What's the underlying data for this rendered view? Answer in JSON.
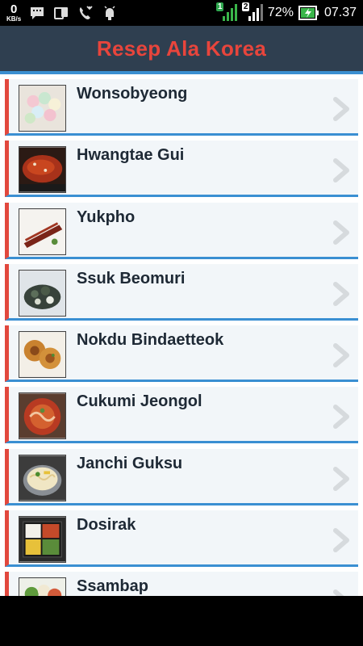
{
  "status_bar": {
    "net_speed_value": "0",
    "net_speed_unit": "KB/s",
    "sim1_label": "1",
    "sim2_label": "2",
    "battery_percent": "72%",
    "time": "07.37",
    "icons": [
      "chat-notification-icon",
      "screen-mirror-icon",
      "missed-call-icon",
      "android-debug-icon",
      "signal-icon",
      "battery-charging-icon"
    ]
  },
  "header": {
    "title": "Resep Ala Korea",
    "title_color": "#e8453c",
    "bg_color": "#2f3f50",
    "accent_color": "#3b8fd1"
  },
  "recipes": [
    {
      "name": "Wonsobyeong",
      "thumb": "rice-balls-thumbnail"
    },
    {
      "name": "Hwangtae Gui",
      "thumb": "grilled-fish-thumbnail"
    },
    {
      "name": "Yukpho",
      "thumb": "beef-jerky-thumbnail"
    },
    {
      "name": "Ssuk Beomuri",
      "thumb": "mugwort-cake-thumbnail"
    },
    {
      "name": "Nokdu Bindaetteok",
      "thumb": "mungbean-pancake-thumbnail"
    },
    {
      "name": "Cukumi Jeongol",
      "thumb": "octopus-hotpot-thumbnail"
    },
    {
      "name": "Janchi Guksu",
      "thumb": "noodle-soup-thumbnail"
    },
    {
      "name": "Dosirak",
      "thumb": "lunchbox-thumbnail"
    },
    {
      "name": "Ssambap",
      "thumb": "wrap-rice-thumbnail"
    }
  ]
}
